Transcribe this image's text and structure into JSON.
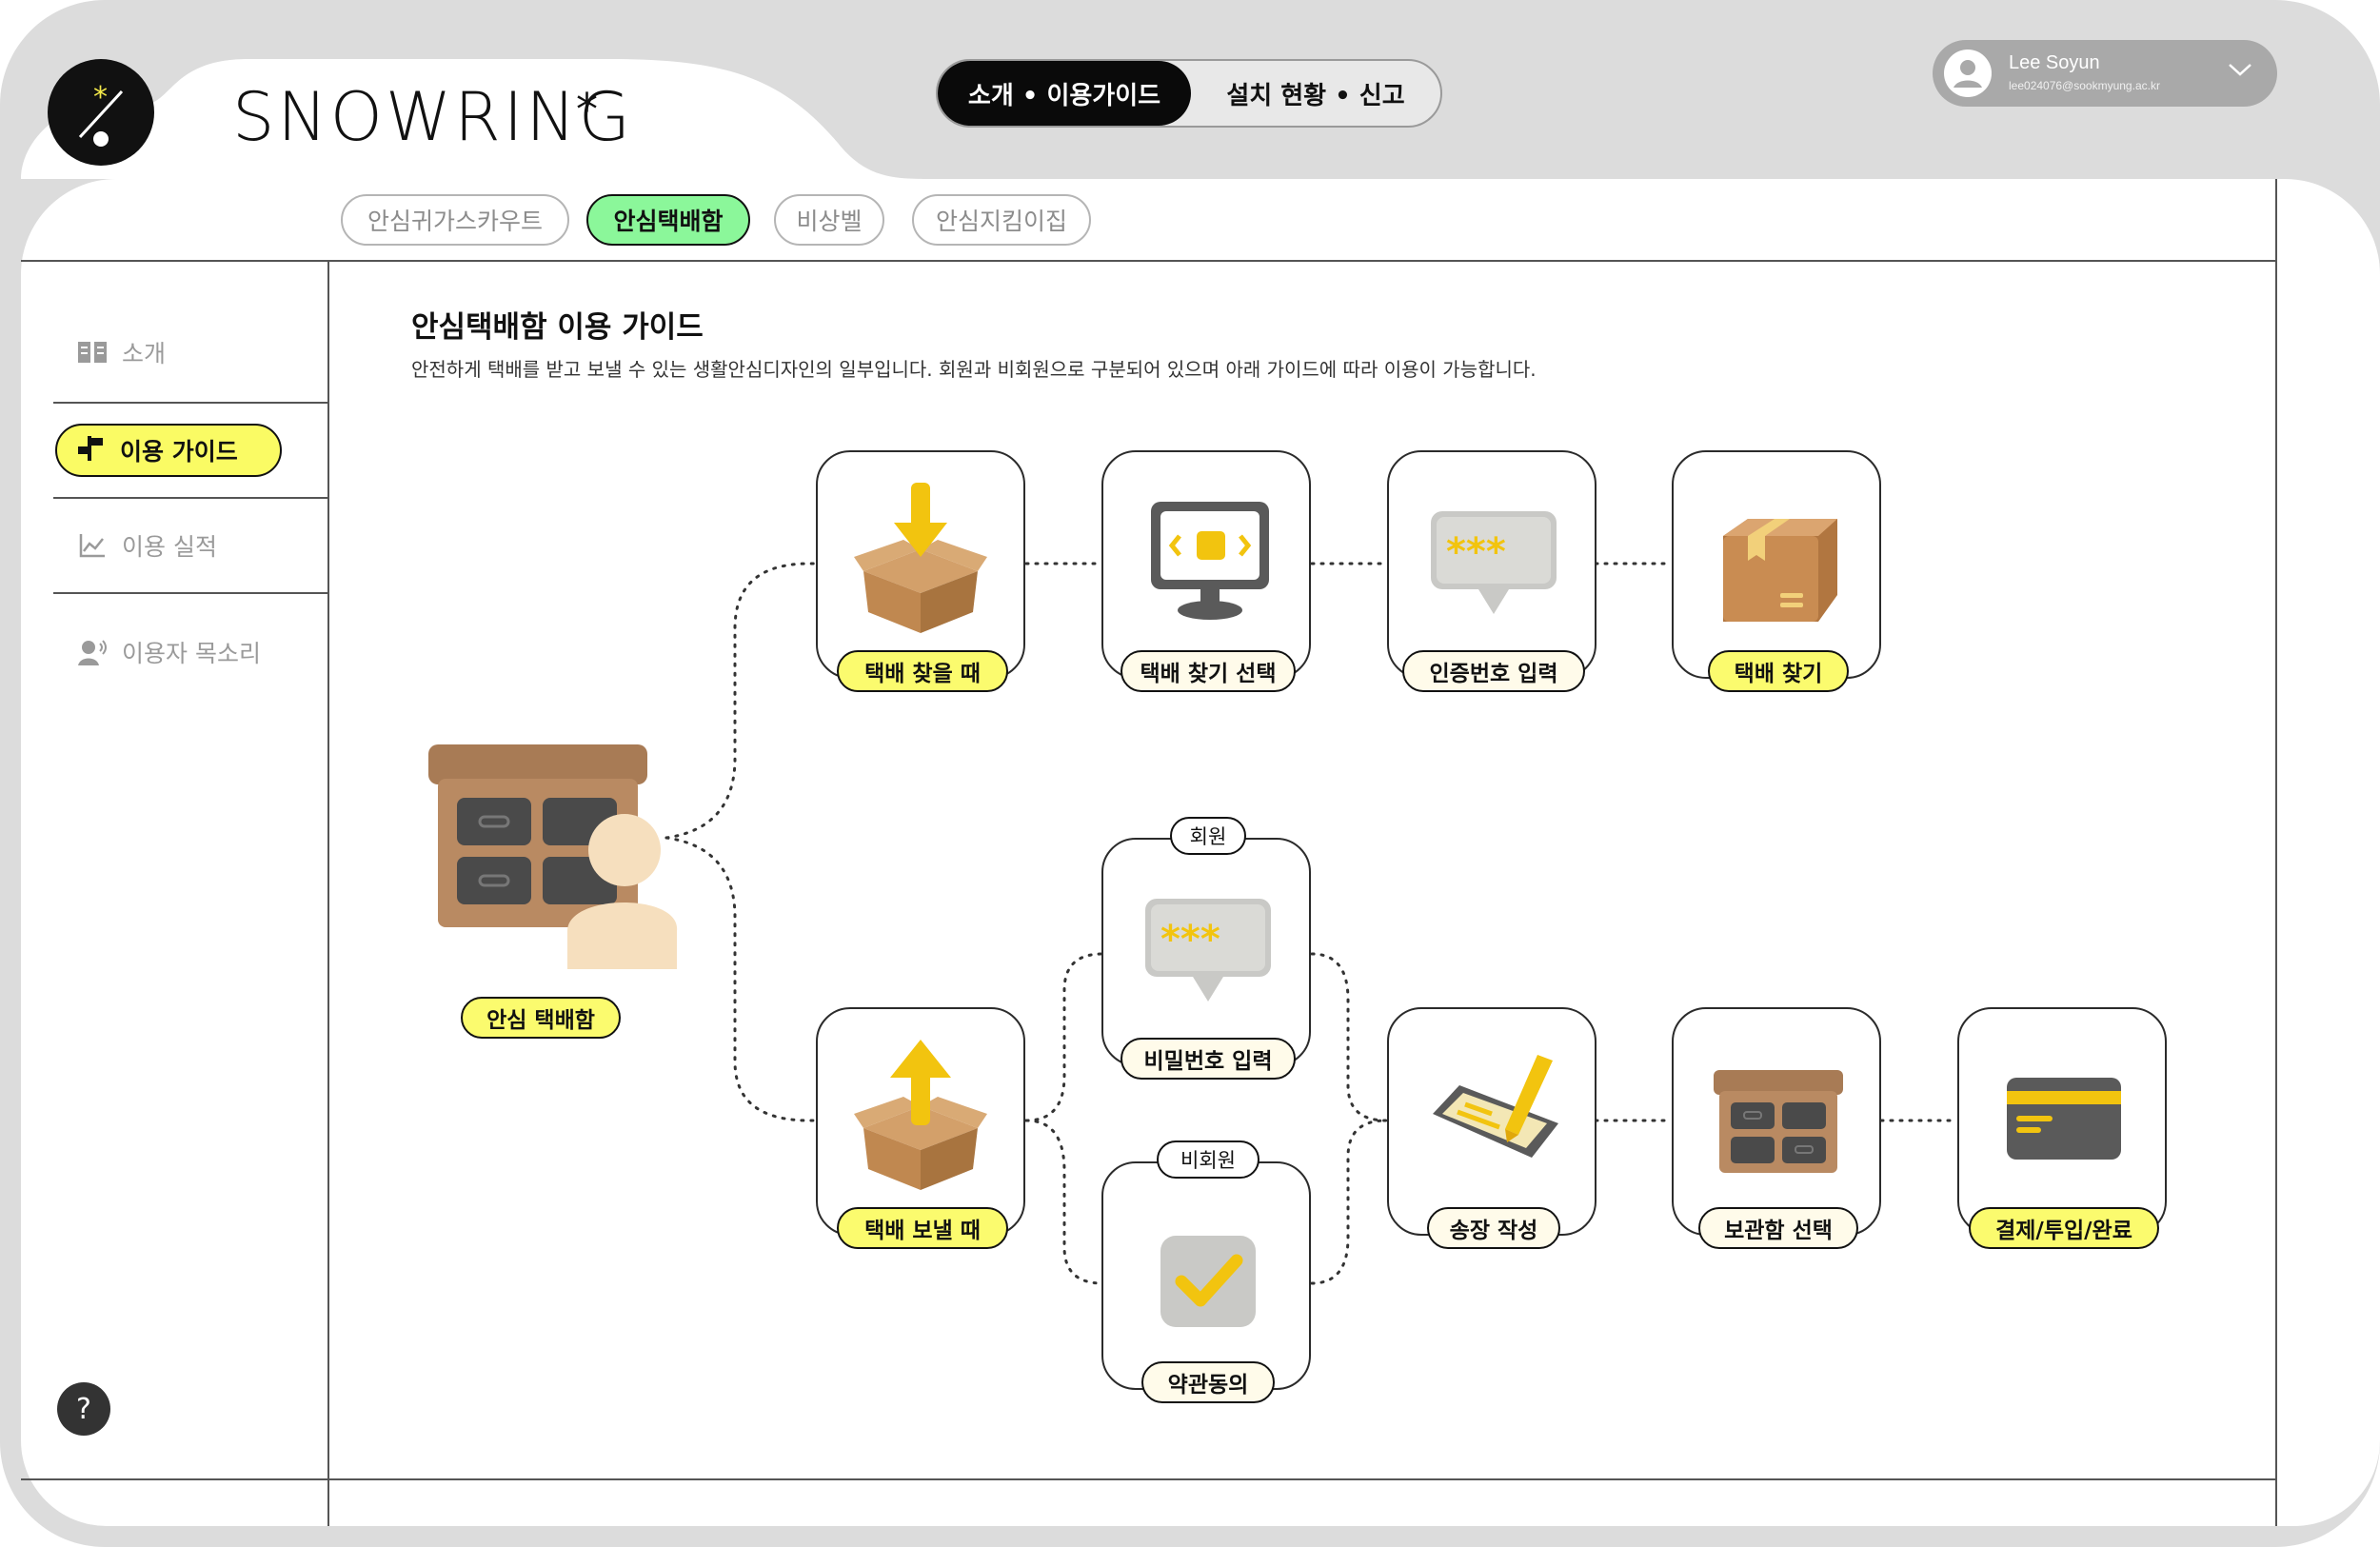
{
  "app": {
    "brand": "SNOWRING",
    "brand_star": "*"
  },
  "top_toggle": {
    "active": "소개 • 이용가이드",
    "inactive": "설치 현황 • 신고"
  },
  "user": {
    "name": "Lee Soyun",
    "email": "lee024076@sookmyung.ac.kr"
  },
  "tabs": [
    {
      "label": "안심귀가스카우트",
      "active": false
    },
    {
      "label": "안심택배함",
      "active": true
    },
    {
      "label": "비상벨",
      "active": false
    },
    {
      "label": "안심지킴이집",
      "active": false
    }
  ],
  "sidebar": {
    "items": [
      {
        "label": "소개",
        "icon": "book-icon",
        "active": false
      },
      {
        "label": "이용 가이드",
        "icon": "signpost-icon",
        "active": true
      },
      {
        "label": "이용 실적",
        "icon": "line-chart-icon",
        "active": false
      },
      {
        "label": "이용자 목소리",
        "icon": "speaker-person-icon",
        "active": false
      }
    ],
    "help": "?"
  },
  "main": {
    "title": "안심택배함 이용 가이드",
    "description": "안전하게 택배를 받고 보낼 수 있는 생활안심디자인의 일부입니다. 회원과 비회원으로 구분되어 있으며 아래 가이드에 따라 이용이 가능합니다."
  },
  "flow": {
    "start": {
      "label": "안심 택배함",
      "icon": "locker-person-icon"
    },
    "receive": [
      {
        "label": "택배 찾을 때",
        "icon": "box-arrow-down-icon",
        "style": "yellow"
      },
      {
        "label": "택배 찾기 선택",
        "icon": "monitor-icon",
        "style": "cream"
      },
      {
        "label": "인증번호 입력",
        "icon": "password-bubble-icon",
        "style": "cream"
      },
      {
        "label": "택배 찾기",
        "icon": "parcel-icon",
        "style": "yellow"
      }
    ],
    "send": [
      {
        "label": "택배 보낼 때",
        "icon": "box-arrow-up-icon",
        "style": "yellow"
      },
      {
        "label": "송장 작성",
        "icon": "pen-tablet-icon",
        "style": "cream"
      },
      {
        "label": "보관함 선택",
        "icon": "locker-icon",
        "style": "cream"
      },
      {
        "label": "결제/투입/완료",
        "icon": "credit-card-icon",
        "style": "yellow"
      }
    ],
    "member": {
      "tag": "회원",
      "label": "비밀번호 입력",
      "icon": "password-bubble-icon"
    },
    "non_member": {
      "tag": "비회원",
      "label": "약관동의",
      "icon": "checkmark-icon"
    }
  },
  "colors": {
    "active_tab": "#8bf79a",
    "highlight_yellow": "#fbfb6e",
    "cream": "#fffbea",
    "frame_gray": "#dcdcdc"
  }
}
